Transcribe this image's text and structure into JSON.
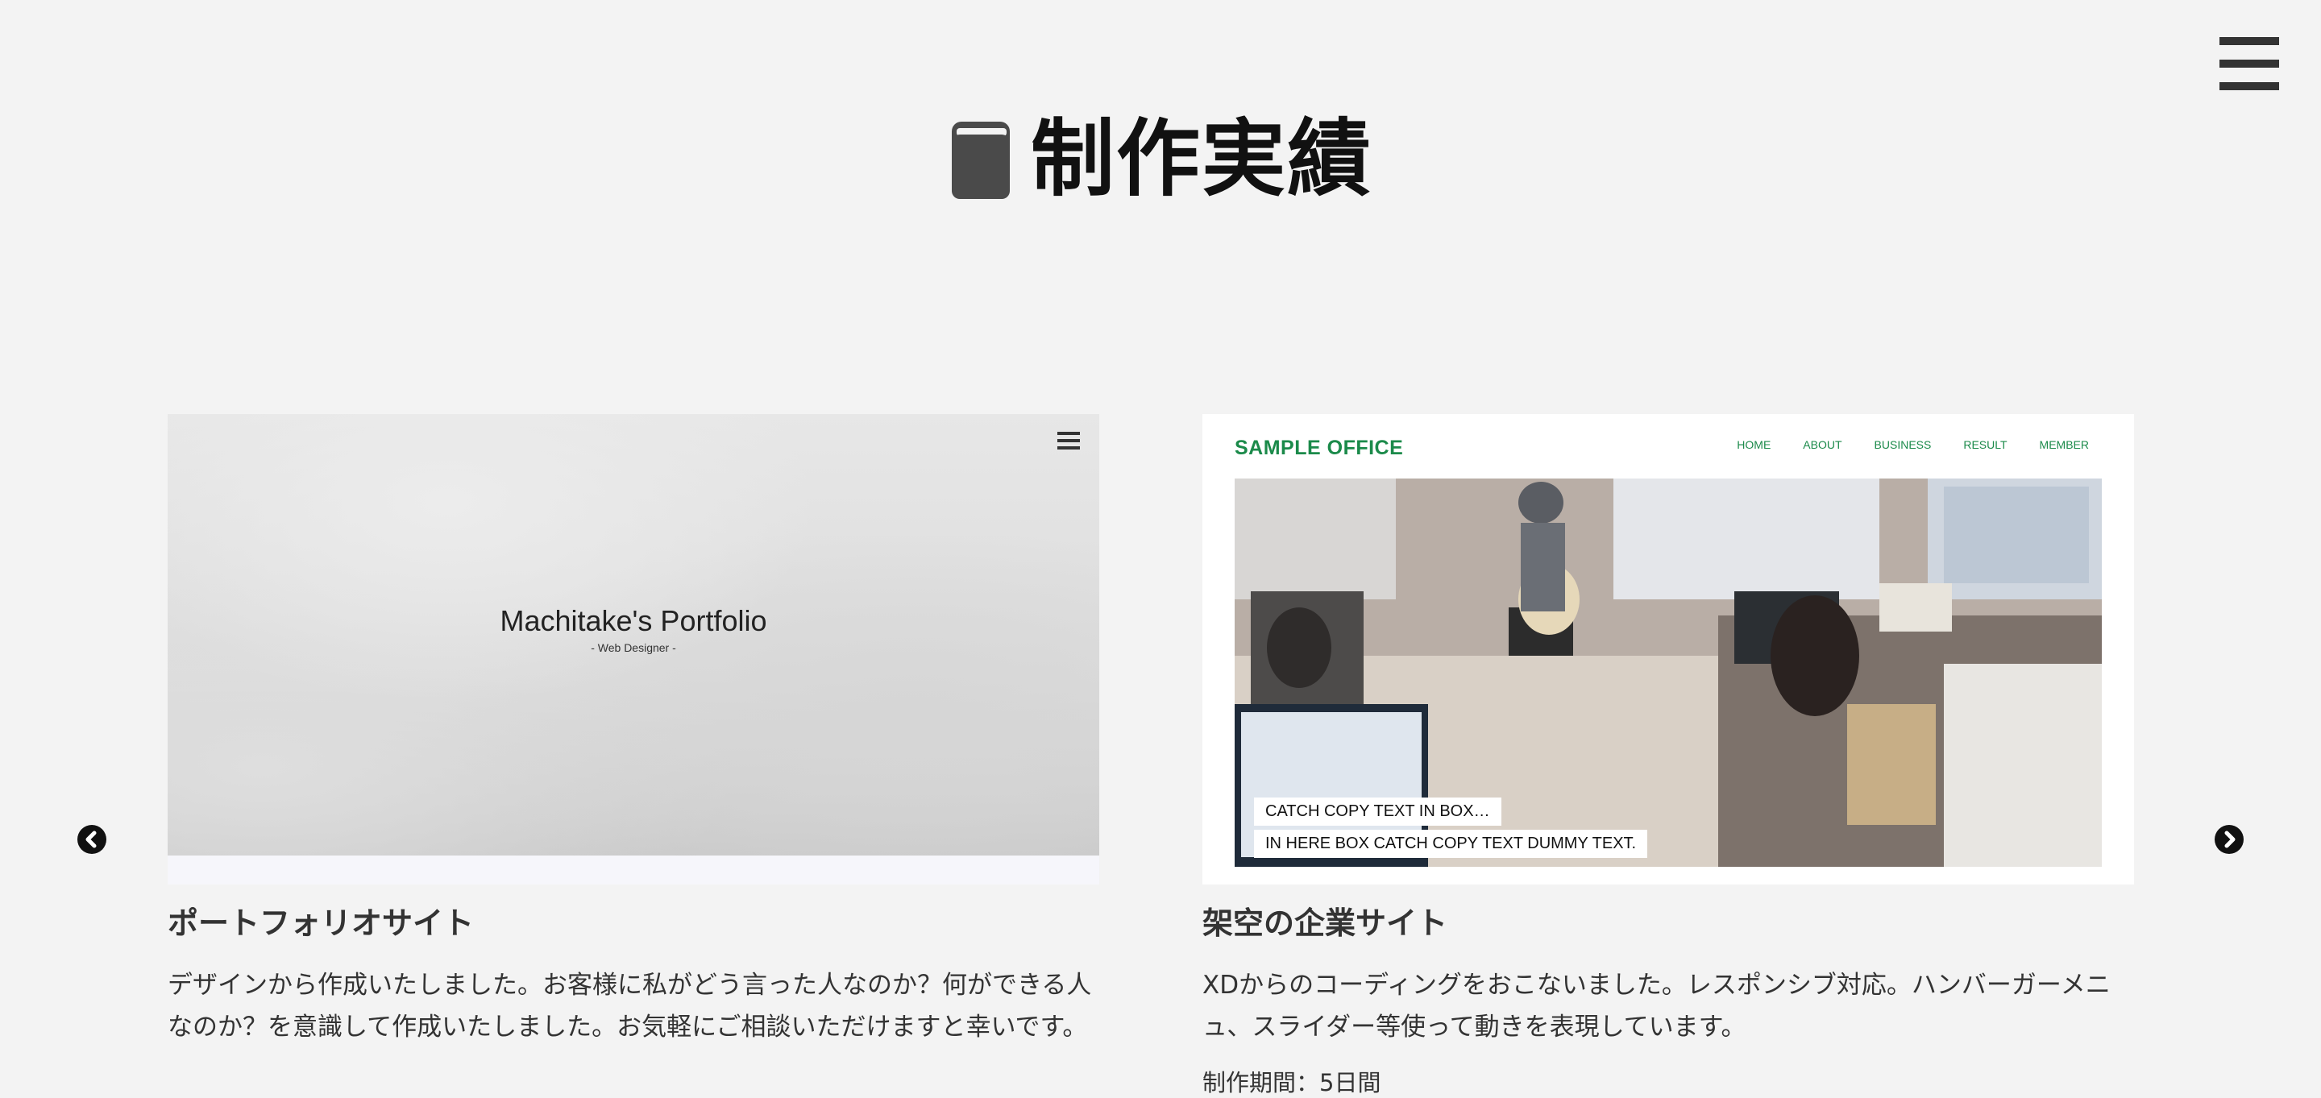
{
  "section": {
    "title": "制作実績"
  },
  "works": [
    {
      "title": "ポートフォリオサイト",
      "description": "デザインから作成いたしました。お客様に私がどう言った人なのか？何ができる人なのか？を意識して作成いたしました。お気軽にご相談いただけますと幸いです。",
      "thumb": {
        "site_title": "Machitake's Portfolio",
        "site_subtitle": "- Web Designer -"
      }
    },
    {
      "title": "架空の企業サイト",
      "description": "XDからのコーディングをおこないました。レスポンシブ対応。ハンバーガーメニュ、スライダー等使って動きを表現しています。",
      "meta": "制作期間：5日間",
      "thumb": {
        "logo": "SAMPLE OFFICE",
        "nav": [
          "HOME",
          "ABOUT",
          "BUSINESS",
          "RESULT",
          "MEMBER"
        ],
        "catch_1": "CATCH COPY TEXT IN BOX…",
        "catch_2": "IN HERE BOX CATCH COPY TEXT DUMMY TEXT."
      }
    }
  ],
  "icons": {
    "menu": "hamburger-icon",
    "heading": "book-icon",
    "prev": "chevron-left-icon",
    "next": "chevron-right-icon"
  },
  "colors": {
    "background": "#f3f3f3",
    "text": "#333333",
    "brand_green": "#1b8a4a"
  }
}
